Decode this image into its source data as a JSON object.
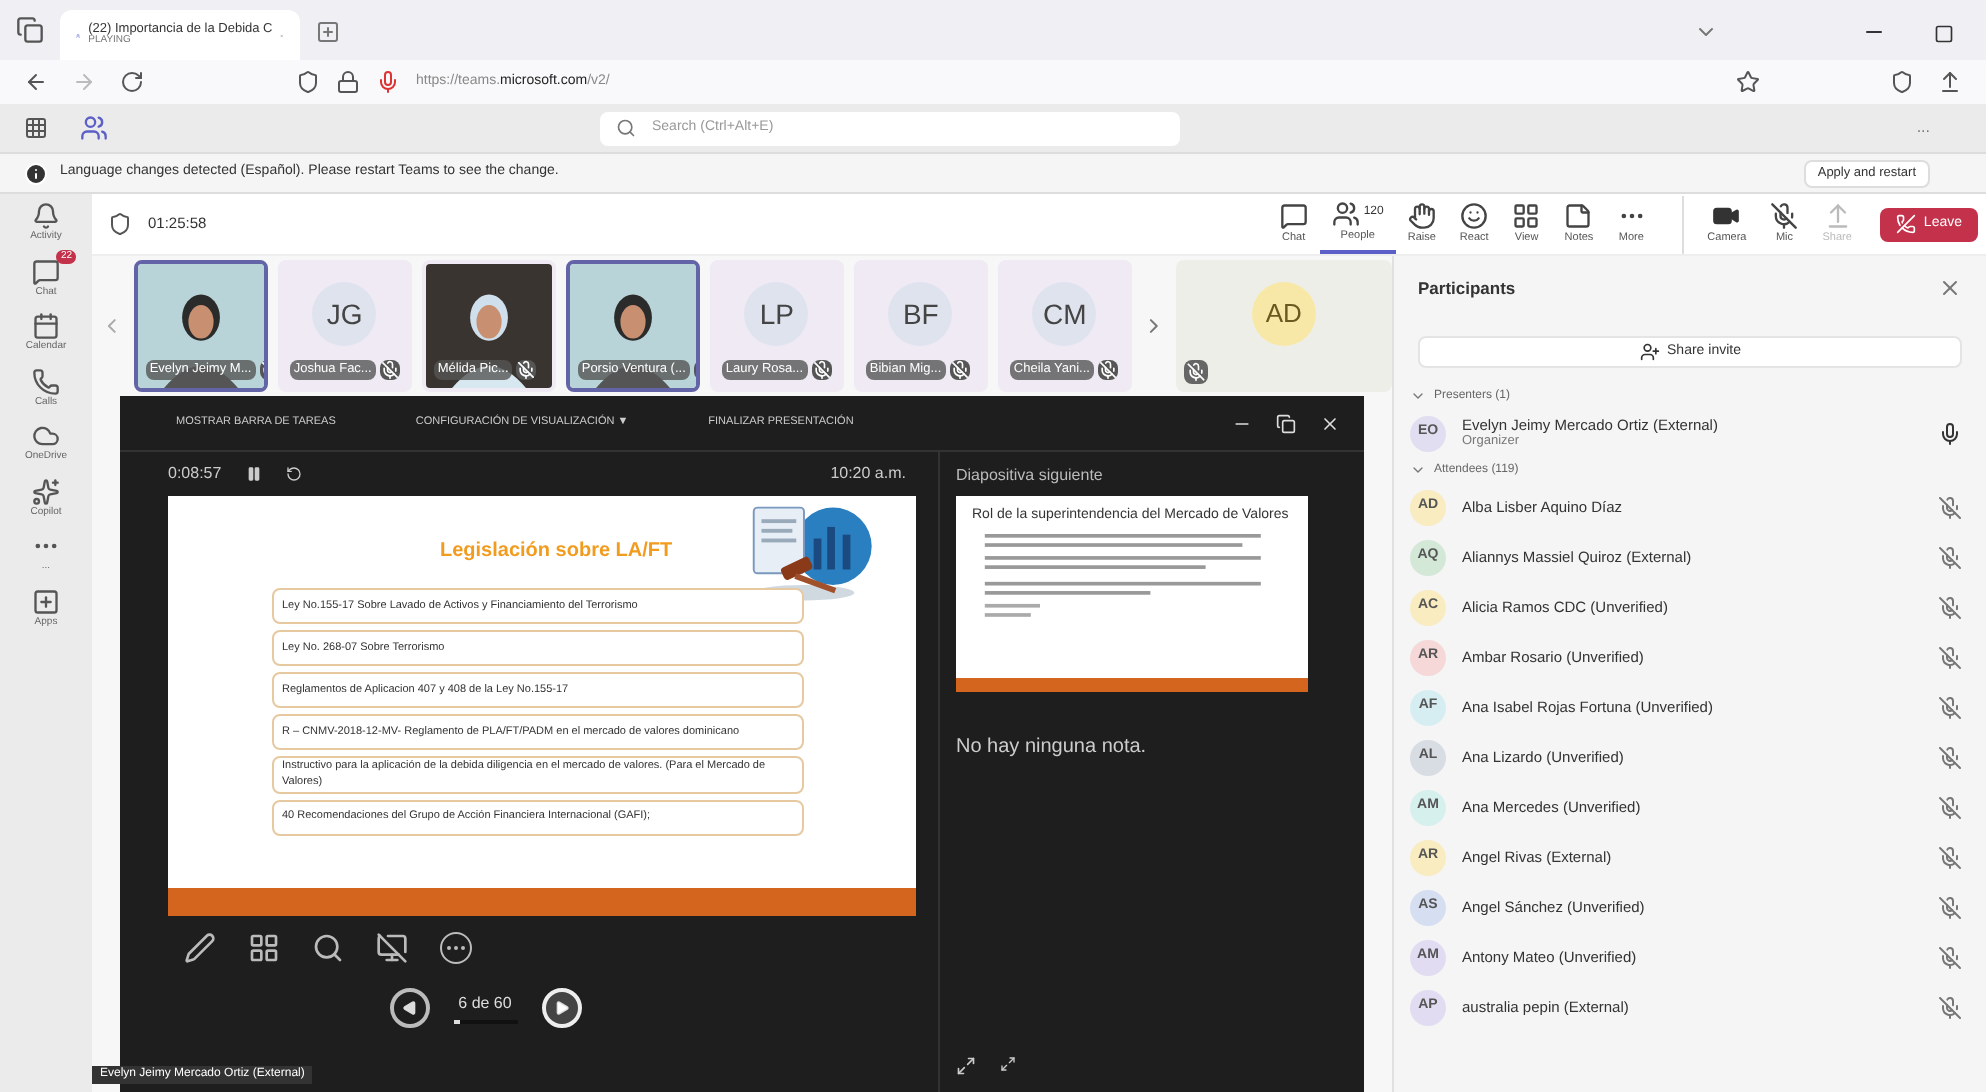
{
  "browser": {
    "tab": {
      "title": "(22) Importancia de la Debida C",
      "subtitle": "PLAYING"
    },
    "url": {
      "prefix": "https://teams.",
      "domain": "microsoft.com",
      "path": "/v2/"
    }
  },
  "teams_bar": {
    "search": {
      "placeholder": "Search (Ctrl+Alt+E)"
    },
    "more": "..."
  },
  "notification": {
    "message": "Language changes detected (Español). Please restart Teams to see the change.",
    "button": "Apply and restart"
  },
  "rail": [
    {
      "kind": "bell",
      "label": "Activity"
    },
    {
      "kind": "chat",
      "label": "Chat",
      "badge": "22"
    },
    {
      "kind": "calendar",
      "label": "Calendar"
    },
    {
      "kind": "calls",
      "label": "Calls"
    },
    {
      "kind": "cloud",
      "label": "OneDrive"
    },
    {
      "kind": "copilot",
      "label": "Copilot"
    },
    {
      "kind": "more",
      "label": "..."
    },
    {
      "kind": "apps",
      "label": "Apps"
    }
  ],
  "meeting": {
    "timer": "01:25:58",
    "controls": [
      {
        "kind": "chat",
        "label": "Chat",
        "selected": false
      },
      {
        "kind": "people",
        "label": "People",
        "count": "120",
        "selected": true
      },
      {
        "kind": "raise",
        "label": "Raise",
        "selected": false
      },
      {
        "kind": "react",
        "label": "React",
        "selected": false
      },
      {
        "kind": "view",
        "label": "View",
        "selected": false
      },
      {
        "kind": "notes",
        "label": "Notes",
        "selected": false
      },
      {
        "kind": "more",
        "label": "More",
        "selected": false
      },
      {
        "kind": "camera",
        "label": "Camera",
        "selected": false
      },
      {
        "kind": "mic",
        "label": "Mic",
        "selected": false
      },
      {
        "kind": "share",
        "label": "Share",
        "selected": false
      }
    ],
    "leave": "Leave"
  },
  "tiles": [
    {
      "kind": "video",
      "name": "Evelyn Jeimy M...",
      "speaking": true
    },
    {
      "kind": "initials",
      "initials": "JG",
      "name": "Joshua Fac...",
      "speaking": false
    },
    {
      "kind": "video",
      "name": "Mélida Pic...",
      "speaking": false
    },
    {
      "kind": "video",
      "name": "Porsio Ventura (...",
      "speaking": true
    },
    {
      "kind": "initials",
      "initials": "LP",
      "name": "Laury Rosa...",
      "speaking": false
    },
    {
      "kind": "initials",
      "initials": "BF",
      "name": "Bibian Mig...",
      "speaking": false
    },
    {
      "kind": "initials",
      "initials": "CM",
      "name": "Cheila Yani...",
      "speaking": false
    }
  ],
  "overflow_tile": {
    "initials": "AD"
  },
  "presentation": {
    "toolbar": [
      "MOSTRAR BARRA DE TAREAS",
      "CONFIGURACIÓN DE VISUALIZACIÓN ▼",
      "FINALIZAR PRESENTACIÓN"
    ],
    "elapsed": "0:08:57",
    "clock": "10:20 a.m.",
    "slide": {
      "title": "Legislación sobre LA/FT",
      "items": [
        "Ley No.155-17 Sobre Lavado de Activos y Financiamiento del Terrorismo",
        "Ley No. 268-07 Sobre Terrorismo",
        "Reglamentos de Aplicacion 407 y 408 de la Ley No.155-17",
        "R – CNMV-2018-12-MV- Reglamento de PLA/FT/PADM en el mercado de valores dominicano",
        "Instructivo para la aplicación de la debida diligencia en el mercado de valores. (Para el Mercado de Valores)",
        "40 Recomendaciones del Grupo de Acción Financiera  Internacional (GAFI);"
      ]
    },
    "counter": "6 de 60",
    "progress": {
      "level": 0.1
    },
    "next_label": "Diapositiva siguiente",
    "next_slide_title": "Rol de la superintendencia del Mercado de Valores",
    "notes": "No hay ninguna nota.",
    "presenter_name": "Evelyn Jeimy Mercado Ortiz (External)"
  },
  "participants": {
    "title": "Participants",
    "share": "Share invite",
    "presenters_label": "Presenters (1)",
    "presenters": [
      {
        "initials": "EO",
        "name": "Evelyn Jeimy Mercado Ortiz (External)",
        "role": "Organizer",
        "color": "#e2def2",
        "muted": false
      }
    ],
    "attendees_label": "Attendees (119)",
    "attendees": [
      {
        "initials": "AD",
        "name": "Alba Lisber Aquino Díaz",
        "color": "#f8ecc0",
        "muted": true
      },
      {
        "initials": "AQ",
        "name": "Aliannys Massiel Quiroz (External)",
        "color": "#d4e8d8",
        "muted": true
      },
      {
        "initials": "AC",
        "name": "Alicia Ramos CDC (Unverified)",
        "color": "#f8ecc0",
        "muted": true
      },
      {
        "initials": "AR",
        "name": "Ambar Rosario (Unverified)",
        "color": "#f6d8d8",
        "muted": true
      },
      {
        "initials": "AF",
        "name": "Ana Isabel Rojas Fortuna (Unverified)",
        "color": "#d6eef2",
        "muted": true
      },
      {
        "initials": "AL",
        "name": "Ana Lizardo (Unverified)",
        "color": "#d8dde3",
        "muted": true
      },
      {
        "initials": "AM",
        "name": "Ana Mercedes (Unverified)",
        "color": "#d6f0ee",
        "muted": true
      },
      {
        "initials": "AR",
        "name": "Angel Rivas (External)",
        "color": "#f8ecc0",
        "muted": true
      },
      {
        "initials": "AS",
        "name": "Angel Sánchez (Unverified)",
        "color": "#d6dff2",
        "muted": true
      },
      {
        "initials": "AM",
        "name": "Antony Mateo (Unverified)",
        "color": "#e2dcf2",
        "muted": true
      },
      {
        "initials": "AP",
        "name": "australia pepin (External)",
        "color": "#e2dcf2",
        "muted": true
      }
    ]
  }
}
